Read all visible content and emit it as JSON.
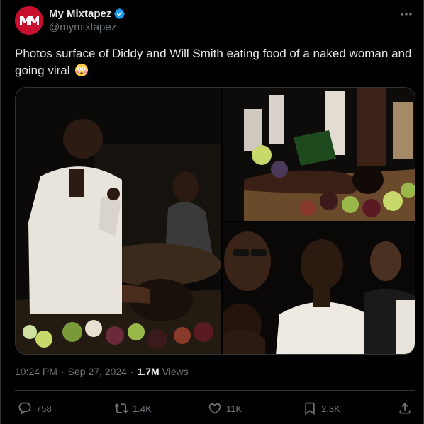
{
  "author": {
    "display_name": "My Mixtapez",
    "handle": "@mymixtapez",
    "avatar_text": "MM",
    "verified": true
  },
  "tweet": {
    "text": "Photos surface of Diddy and Will Smith eating food of a naked woman and going viral",
    "emoji": "flushed-face-emoji"
  },
  "meta": {
    "time": "10:24 PM",
    "separator": "·",
    "date": "Sep 27, 2024",
    "views_count": "1.7M",
    "views_label": "Views"
  },
  "actions": {
    "replies": "758",
    "reposts": "1.4K",
    "likes": "11K",
    "bookmarks": "2.3K"
  },
  "colors": {
    "background": "#000000",
    "text": "#e7e9ea",
    "muted": "#71767b",
    "verified": "#1d9bf0",
    "avatar": "#c8102e",
    "border": "#2f3336"
  }
}
